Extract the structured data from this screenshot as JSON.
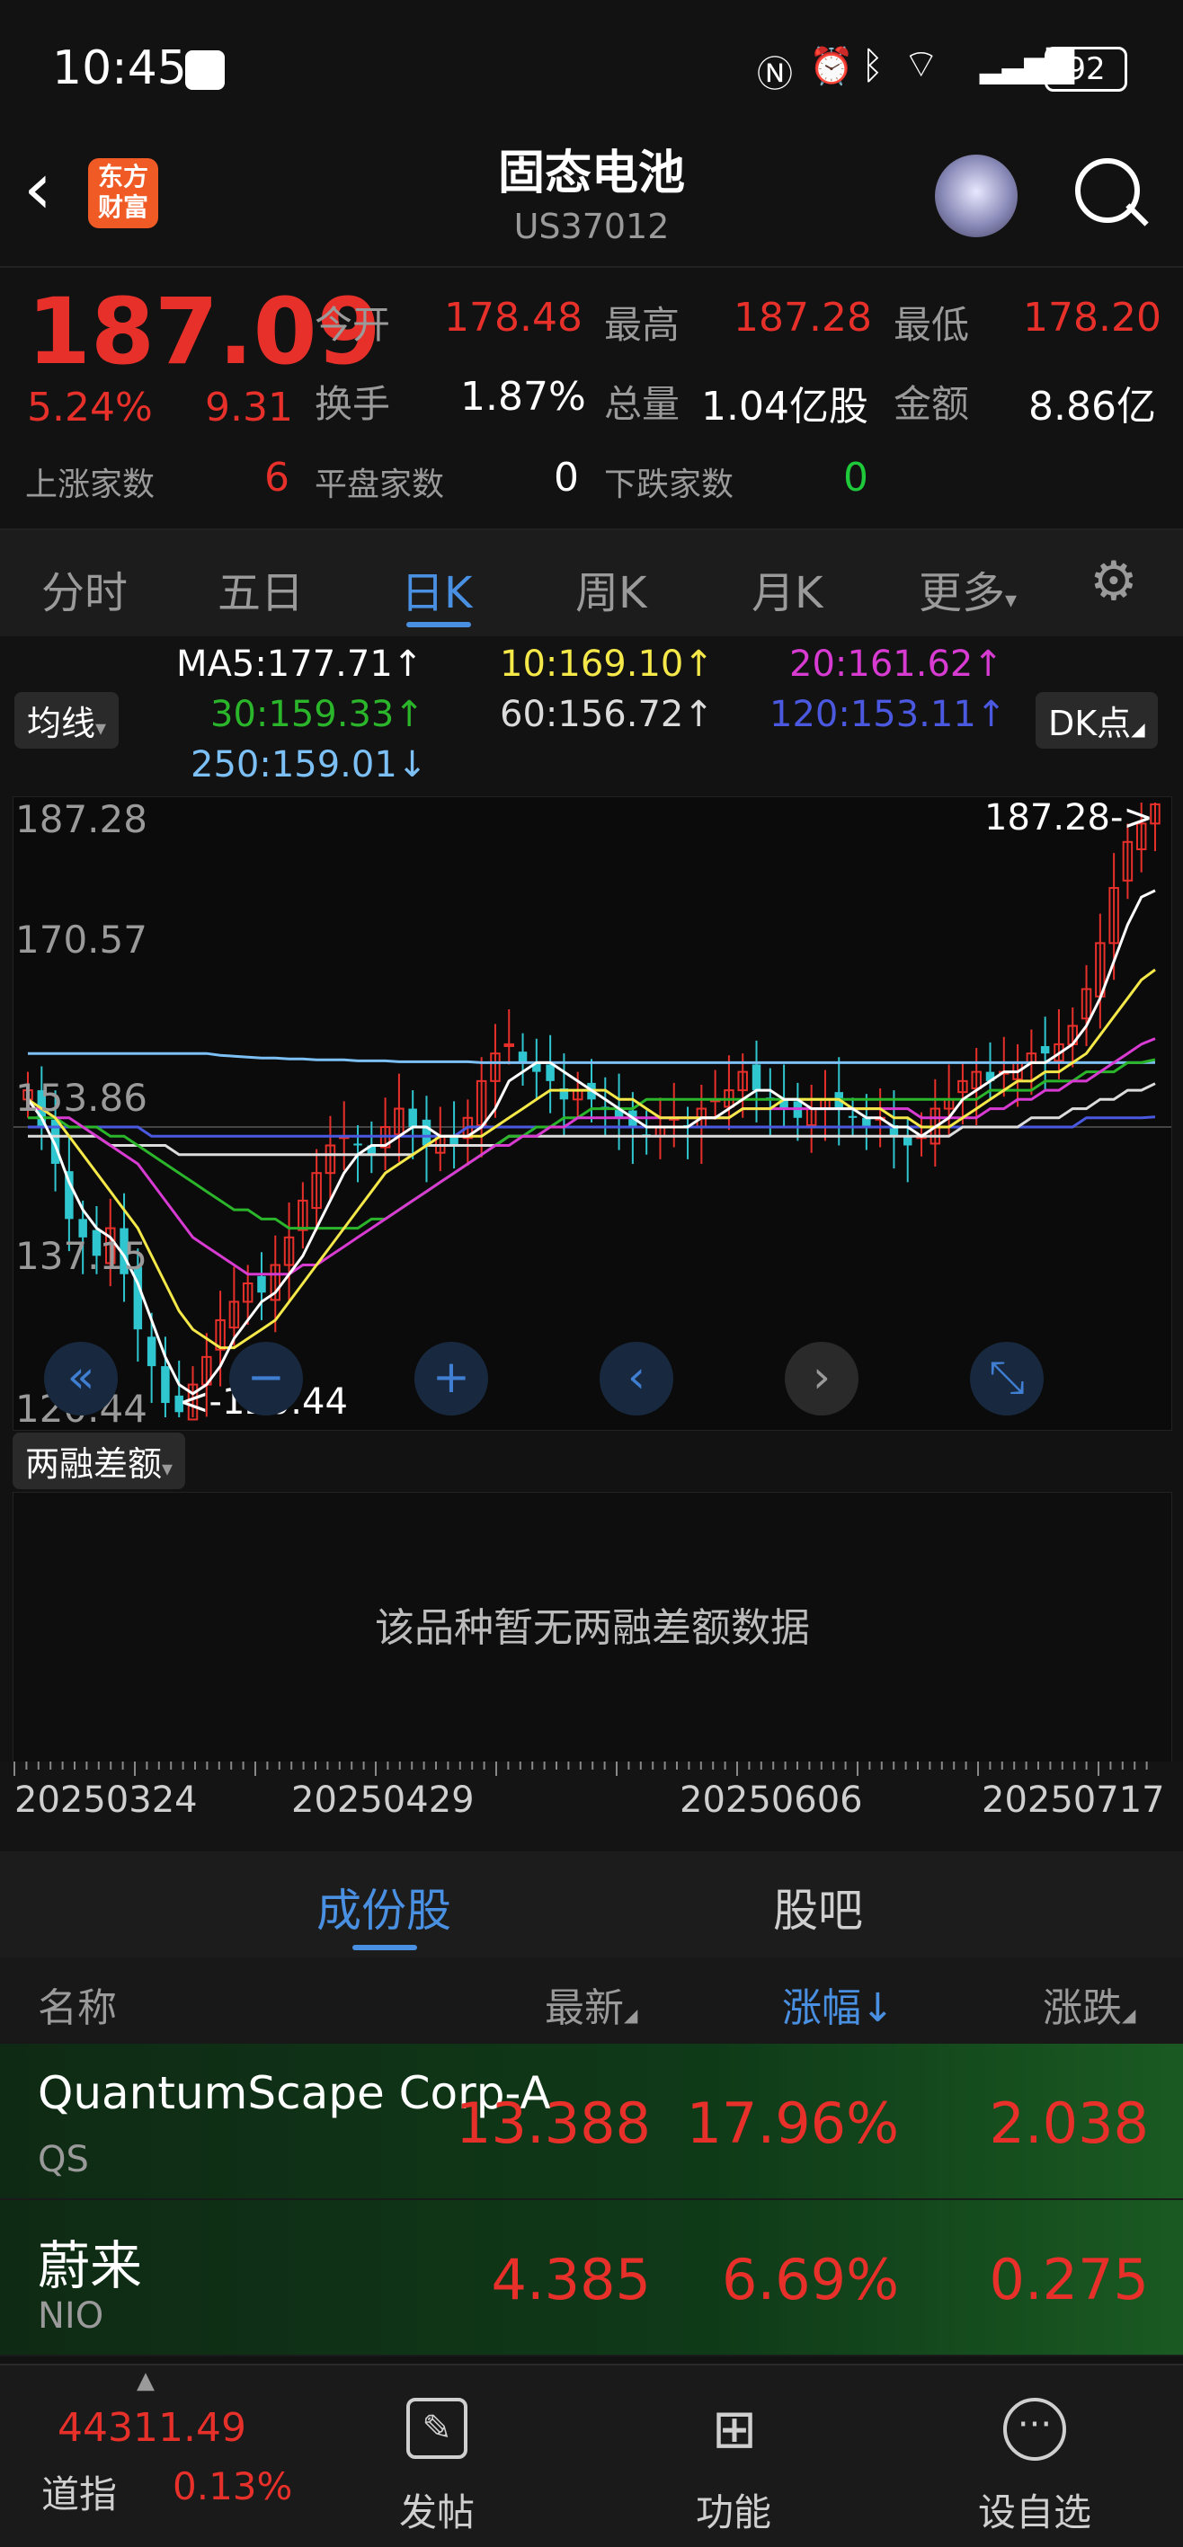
{
  "status_bar": {
    "time": "10:45",
    "battery": "92"
  },
  "header": {
    "logo_line1": "东方",
    "logo_line2": "财富",
    "title": "固态电池",
    "subtitle": "US37012"
  },
  "quote": {
    "price": "187.09",
    "change_pct": "5.24%",
    "change": "9.31",
    "open_label": "今开",
    "open": "178.48",
    "high_label": "最高",
    "high": "187.28",
    "low_label": "最低",
    "low": "178.20",
    "turnover_label": "换手",
    "turnover": "1.87%",
    "volume_label": "总量",
    "volume": "1.04亿股",
    "amount_label": "金额",
    "amount": "8.86亿",
    "up_label": "上涨家数",
    "up": "6",
    "flat_label": "平盘家数",
    "flat": "0",
    "down_label": "下跌家数",
    "down": "0"
  },
  "tabs": [
    "分时",
    "五日",
    "日K",
    "周K",
    "月K",
    "更多"
  ],
  "active_tab": "日K",
  "ma_legend": {
    "selector": "均线",
    "ma5": "MA5:177.71↑",
    "ma10": "10:169.10↑",
    "ma20": "20:161.62↑",
    "ma30": "30:159.33↑",
    "ma60": "60:156.72↑",
    "ma120": "120:153.11↑",
    "ma250": "250:159.01↓",
    "dk": "DK点",
    "colors": {
      "ma5": "#ffffff",
      "ma10": "#f5e94a",
      "ma20": "#d83bd2",
      "ma30": "#2bb52b",
      "ma60": "#dcdcdc",
      "ma120": "#4b59e0",
      "ma250": "#7cc0f5"
    }
  },
  "chart": {
    "y_labels": [
      "187.28",
      "170.57",
      "153.86",
      "137.15",
      "120.44"
    ],
    "max_marker": "187.28->",
    "min_marker": "<-120.44",
    "nav_buttons": [
      "«",
      "−",
      "+",
      "‹",
      "›",
      "⤡"
    ]
  },
  "chart_data": {
    "type": "candlestick",
    "ylim": [
      120.44,
      187.28
    ],
    "x_dates": [
      "20250324",
      "20250429",
      "20250606",
      "20250717"
    ],
    "high": 187.28,
    "low": 120.44,
    "close_series": [
      156,
      152,
      148,
      142,
      140,
      138,
      141,
      136,
      130,
      126,
      122,
      121,
      124,
      127,
      131,
      133,
      135,
      134,
      137,
      140,
      144,
      147,
      150,
      151,
      150,
      149,
      152,
      154,
      152,
      150,
      151,
      150,
      153,
      157,
      160,
      161,
      159,
      158,
      157,
      155,
      156,
      155,
      154,
      153,
      152,
      151,
      152,
      153,
      152,
      154,
      155,
      156,
      158,
      156,
      155,
      154,
      153,
      154,
      155,
      154,
      153,
      152,
      153,
      151,
      150,
      151,
      154,
      155,
      157,
      158,
      157,
      158,
      159,
      160,
      160,
      161,
      163,
      167,
      172,
      178,
      183,
      185,
      187.09
    ],
    "ma5": [
      155,
      153,
      150,
      146,
      143,
      141,
      140,
      138,
      135,
      131,
      127,
      124,
      123,
      124,
      126,
      129,
      131,
      133,
      134,
      136,
      138,
      141,
      144,
      147,
      149,
      150,
      150,
      151,
      152,
      152,
      151,
      151,
      151,
      152,
      154,
      157,
      158,
      159,
      159,
      158,
      157,
      156,
      155,
      154,
      153,
      152,
      152,
      152,
      152,
      153,
      153,
      154,
      155,
      156,
      156,
      155,
      155,
      154,
      154,
      154,
      154,
      153,
      153,
      152,
      152,
      151,
      152,
      153,
      155,
      156,
      157,
      158,
      158,
      159,
      159,
      160,
      161,
      163,
      166,
      170,
      174,
      177,
      177.71
    ],
    "ma10": [
      155,
      154,
      153,
      151,
      149,
      147,
      145,
      143,
      141,
      138,
      135,
      132,
      130,
      129,
      128,
      128,
      129,
      130,
      131,
      133,
      135,
      137,
      139,
      141,
      143,
      145,
      147,
      148,
      149,
      150,
      151,
      151,
      151,
      151,
      152,
      153,
      154,
      155,
      156,
      156,
      156,
      156,
      156,
      155,
      155,
      154,
      153,
      153,
      153,
      153,
      153,
      153,
      154,
      154,
      154,
      155,
      155,
      155,
      155,
      155,
      154,
      154,
      154,
      153,
      153,
      152,
      152,
      152,
      153,
      154,
      155,
      156,
      157,
      157,
      158,
      158,
      159,
      160,
      162,
      164,
      166,
      168,
      169.1
    ],
    "ma20": [
      154,
      154,
      153,
      153,
      152,
      151,
      150,
      149,
      148,
      146,
      144,
      142,
      140,
      139,
      138,
      137,
      136,
      136,
      136,
      136,
      137,
      137,
      138,
      139,
      140,
      141,
      142,
      143,
      144,
      145,
      146,
      147,
      148,
      149,
      150,
      150,
      151,
      151,
      152,
      152,
      153,
      153,
      153,
      153,
      153,
      153,
      153,
      153,
      153,
      153,
      153,
      153,
      154,
      154,
      154,
      154,
      154,
      154,
      154,
      154,
      154,
      154,
      154,
      154,
      154,
      153,
      153,
      153,
      153,
      153,
      154,
      154,
      155,
      155,
      156,
      156,
      157,
      157,
      158,
      159,
      160,
      161,
      161.62
    ],
    "ma30": [
      153,
      153,
      153,
      152,
      152,
      152,
      151,
      151,
      150,
      149,
      148,
      147,
      146,
      145,
      144,
      143,
      143,
      142,
      142,
      141,
      141,
      141,
      141,
      141,
      141,
      142,
      142,
      143,
      144,
      145,
      146,
      147,
      148,
      149,
      150,
      151,
      151,
      152,
      152,
      153,
      153,
      154,
      154,
      154,
      154,
      155,
      155,
      155,
      155,
      155,
      155,
      155,
      155,
      155,
      155,
      155,
      155,
      155,
      155,
      155,
      155,
      155,
      155,
      155,
      155,
      155,
      155,
      155,
      155,
      155,
      156,
      156,
      156,
      156,
      157,
      157,
      157,
      158,
      158,
      158,
      159,
      159,
      159.33
    ],
    "ma60": [
      151,
      151,
      151,
      151,
      151,
      151,
      150,
      150,
      150,
      150,
      150,
      149,
      149,
      149,
      149,
      149,
      149,
      149,
      149,
      149,
      149,
      149,
      149,
      149,
      149,
      149,
      149,
      149,
      149,
      150,
      150,
      150,
      150,
      150,
      150,
      151,
      151,
      151,
      151,
      151,
      151,
      151,
      151,
      151,
      151,
      151,
      151,
      151,
      151,
      151,
      151,
      151,
      151,
      151,
      151,
      151,
      151,
      151,
      151,
      151,
      151,
      151,
      151,
      151,
      151,
      151,
      151,
      151,
      152,
      152,
      152,
      152,
      152,
      153,
      153,
      153,
      154,
      154,
      155,
      155,
      156,
      156,
      156.72
    ],
    "ma120": [
      152,
      152,
      152,
      152,
      152,
      152,
      152,
      152,
      152,
      151,
      151,
      151,
      151,
      151,
      151,
      151,
      151,
      151,
      151,
      151,
      151,
      151,
      151,
      151,
      151,
      151,
      151,
      151,
      151,
      151,
      151,
      151,
      152,
      152,
      152,
      152,
      152,
      152,
      152,
      152,
      152,
      152,
      152,
      152,
      152,
      152,
      152,
      152,
      152,
      152,
      152,
      152,
      152,
      152,
      152,
      152,
      152,
      152,
      152,
      152,
      152,
      152,
      152,
      152,
      152,
      152,
      152,
      152,
      152,
      152,
      152,
      152,
      152,
      152,
      152,
      152,
      152,
      153,
      153,
      153,
      153,
      153,
      153.11
    ],
    "ma250": [
      160,
      160,
      160,
      160,
      160,
      160,
      160,
      160,
      160,
      160,
      160,
      160,
      160,
      160,
      159.8,
      159.7,
      159.6,
      159.5,
      159.5,
      159.4,
      159.4,
      159.3,
      159.3,
      159.3,
      159.2,
      159.2,
      159.2,
      159.1,
      159.1,
      159.1,
      159.1,
      159.1,
      159.1,
      159,
      159,
      159,
      159,
      159,
      159,
      159,
      159,
      159,
      159,
      159,
      159,
      159,
      159,
      159,
      159,
      159,
      159,
      159,
      159,
      159,
      159,
      159,
      159,
      159,
      159,
      159,
      159,
      159,
      159,
      159,
      159,
      159,
      159,
      159,
      159,
      159,
      159,
      159,
      159,
      159,
      159,
      159,
      159,
      159,
      159,
      159,
      159,
      159,
      159.01
    ]
  },
  "margin_panel": {
    "selector": "两融差额",
    "empty_text": "该品种暂无两融差额数据"
  },
  "dates": [
    "20250324",
    "20250429",
    "20250606",
    "20250717"
  ],
  "list_tabs": [
    "成份股",
    "股吧"
  ],
  "list_header": {
    "name": "名称",
    "latest": "最新",
    "pct": "涨幅↓",
    "change": "涨跌"
  },
  "list": [
    {
      "name": "QuantumScape Corp-A",
      "code": "QS",
      "latest": "13.388",
      "pct": "17.96%",
      "change": "2.038"
    },
    {
      "name": "蔚来",
      "code": "NIO",
      "latest": "4.385",
      "pct": "6.69%",
      "change": "0.275"
    }
  ],
  "bottom_nav": {
    "index_value": "44311.49",
    "index_name": "道指",
    "index_pct": "0.13%",
    "items": [
      "发帖",
      "功能",
      "设自选"
    ]
  }
}
